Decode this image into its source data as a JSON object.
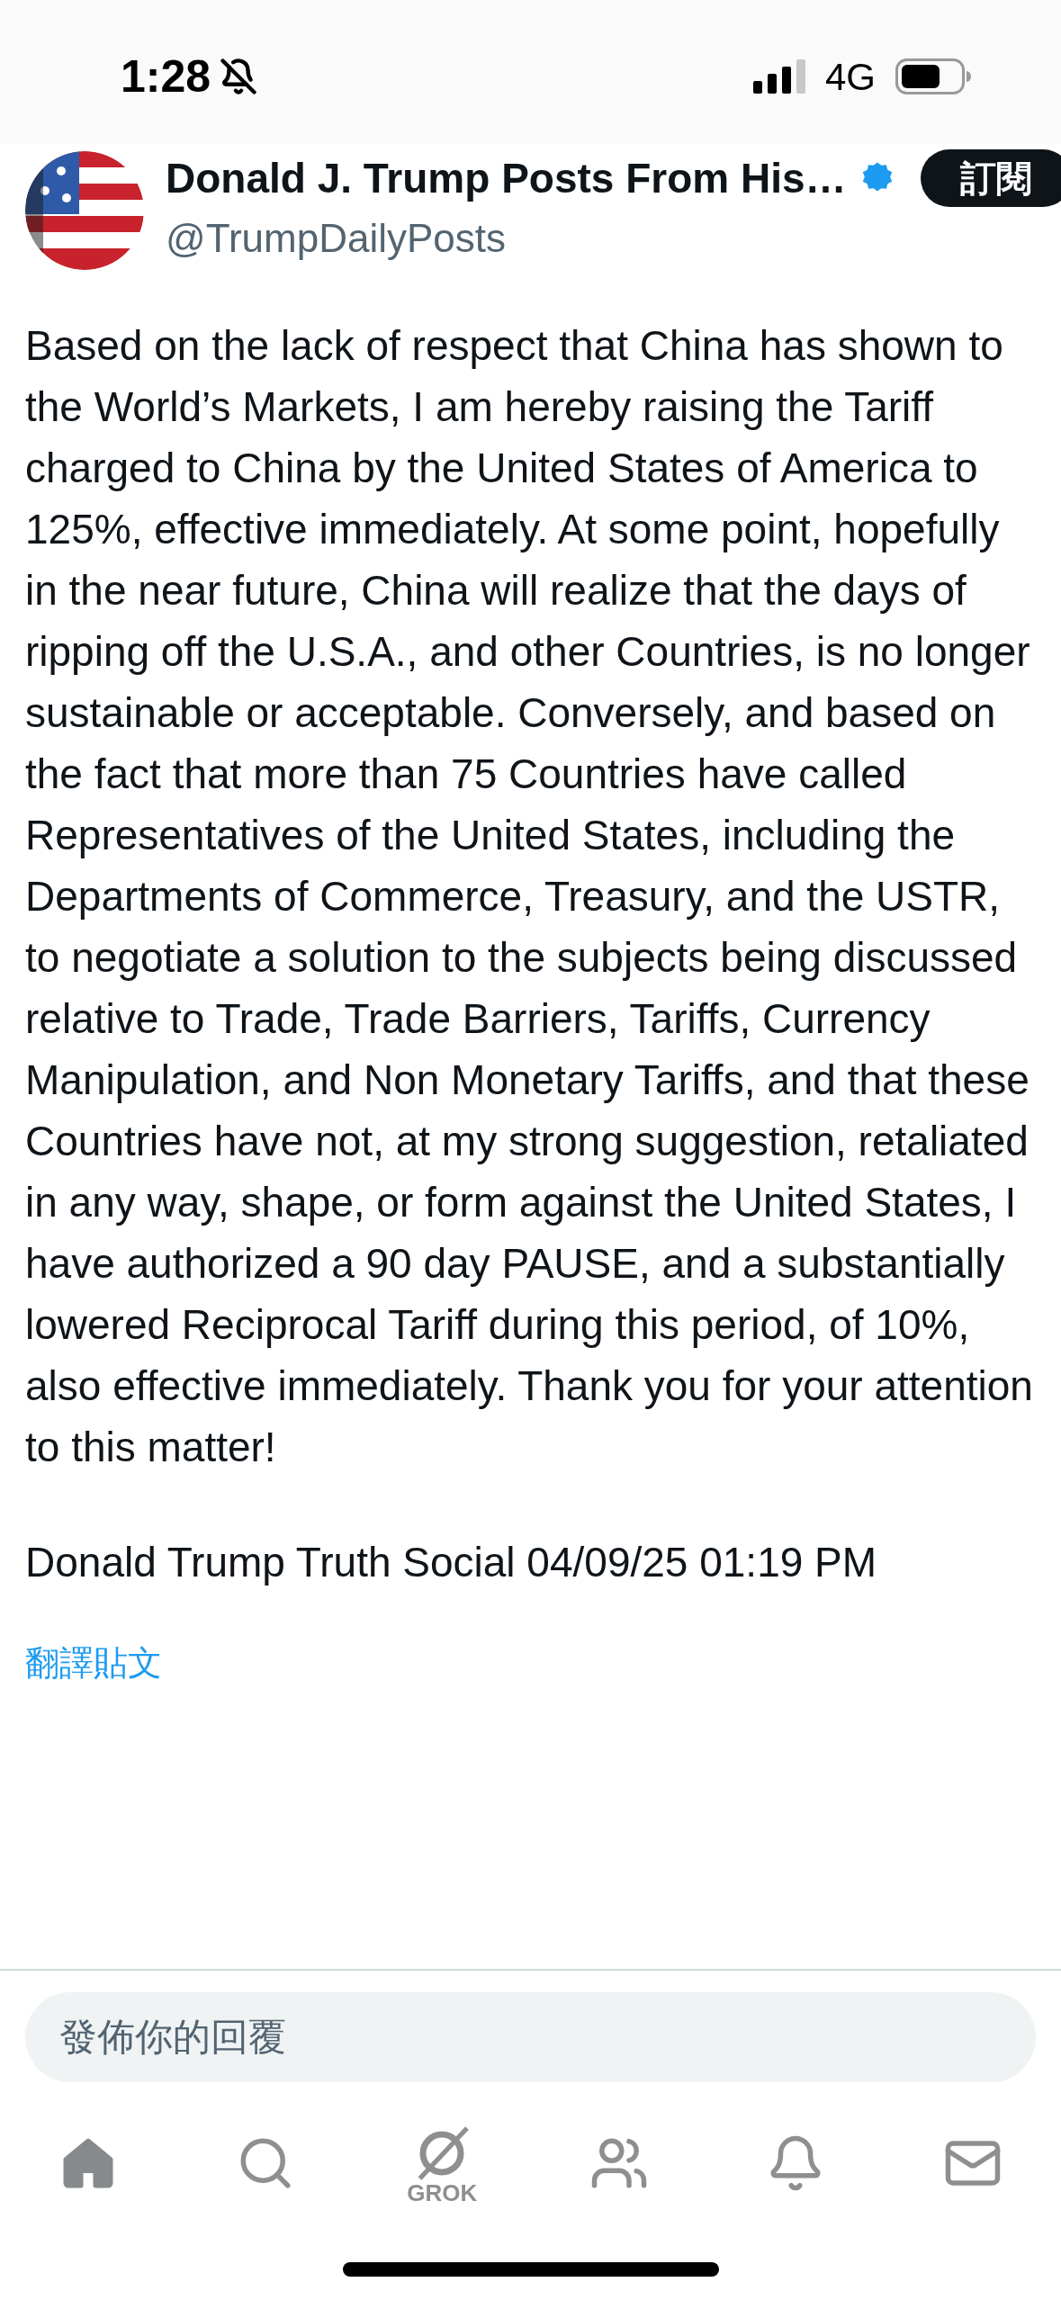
{
  "status_bar": {
    "time": "1:28",
    "network": "4G"
  },
  "post": {
    "author": {
      "name": "Donald J. Trump Posts From His…",
      "handle": "@TrumpDailyPosts",
      "verified": true
    },
    "subscribe_button": "訂閱",
    "body": "Based on the lack of respect that China has shown to the World’s Markets, I am hereby raising the Tariff charged to China by the United States of America to 125%, effective immediately. At some point, hopefully in the near future, China will realize that the days of ripping off the U.S.A., and other Countries, is no longer sustainable or acceptable. Conversely, and based on the fact that more than 75 Countries have called Representatives of the United States, including the Departments of Commerce, Treasury, and the USTR, to negotiate a solution to the subjects being discussed relative to Trade, Trade Barriers, Tariffs, Currency Manipulation, and Non Monetary Tariffs, and that these Countries have not, at my strong suggestion, retaliated in any way, shape, or form against the United States, I have authorized a 90 day PAUSE, and a substantially lowered Reciprocal Tariff during this period, of 10%, also effective immediately. Thank you for your attention to this matter!",
    "signature": "Donald Trump Truth Social 04/09/25 01:19 PM",
    "translate_link": "翻譯貼文"
  },
  "reply": {
    "placeholder": "發佈你的回覆"
  },
  "tab_bar": {
    "items": [
      {
        "kind": "home",
        "selected": true
      },
      {
        "kind": "search",
        "selected": false
      },
      {
        "kind": "grok",
        "label": "GROK",
        "selected": false
      },
      {
        "kind": "people",
        "selected": false
      },
      {
        "kind": "bell",
        "selected": false
      },
      {
        "kind": "mail",
        "selected": false
      }
    ]
  }
}
